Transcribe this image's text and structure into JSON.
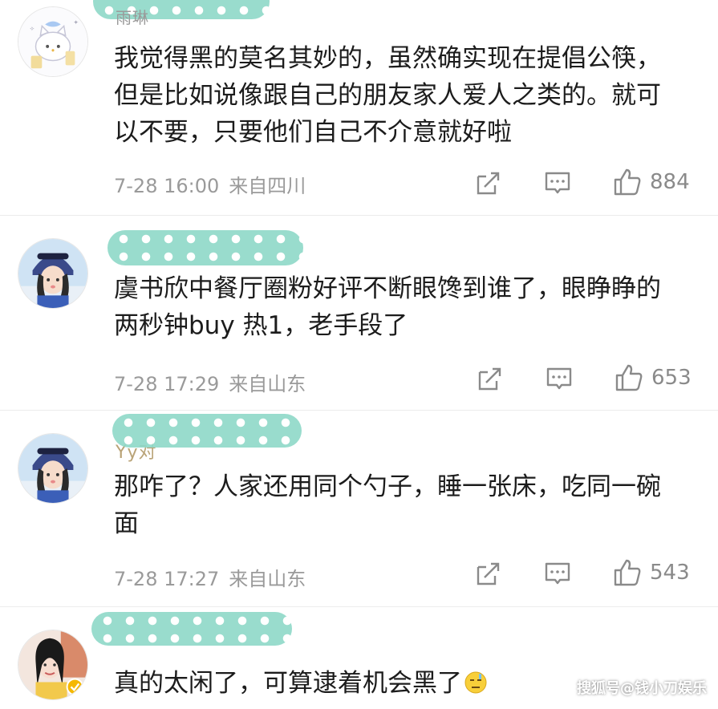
{
  "comments": [
    {
      "username_peek": "雨琳",
      "text": "我觉得黑的莫名其妙的，虽然确实现在提倡公筷，但是比如说像跟自己的朋友家人爱人之类的。就可以不要，只要他们自己不介意就好啦",
      "time": "7-28 16:00",
      "location": "来自四川",
      "likes": "884",
      "avatar": "cartoon-cat-avatar"
    },
    {
      "username_peek": "",
      "text": "虞书欣中餐厅圈粉好评不断眼馋到谁了，眼睁睁的两秒钟buy 热1，老手段了",
      "time": "7-28 17:29",
      "location": "来自山东",
      "likes": "653",
      "avatar": "girl-helmet-avatar"
    },
    {
      "username_peek": "Yy对",
      "text": "那咋了？人家还用同个勺子，睡一张床，吃同一碗面",
      "time": "7-28 17:27",
      "location": "来自山东",
      "likes": "543",
      "avatar": "girl-helmet-avatar"
    },
    {
      "username_peek": "",
      "text": "真的太闲了，可算逮着机会黑了",
      "time": "",
      "location": "",
      "likes": "",
      "avatar": "girl-photo-avatar",
      "emoji": "embarrassed-emoji"
    }
  ],
  "watermark": "搜狐号@钱小刀娱乐",
  "colors": {
    "name_mask": "#8fd9c8",
    "meta_text": "#9a9a9a",
    "body_text": "#1c1c1c"
  },
  "icons": {
    "repost": "repost-icon",
    "comment": "comment-icon",
    "like": "like-icon"
  }
}
